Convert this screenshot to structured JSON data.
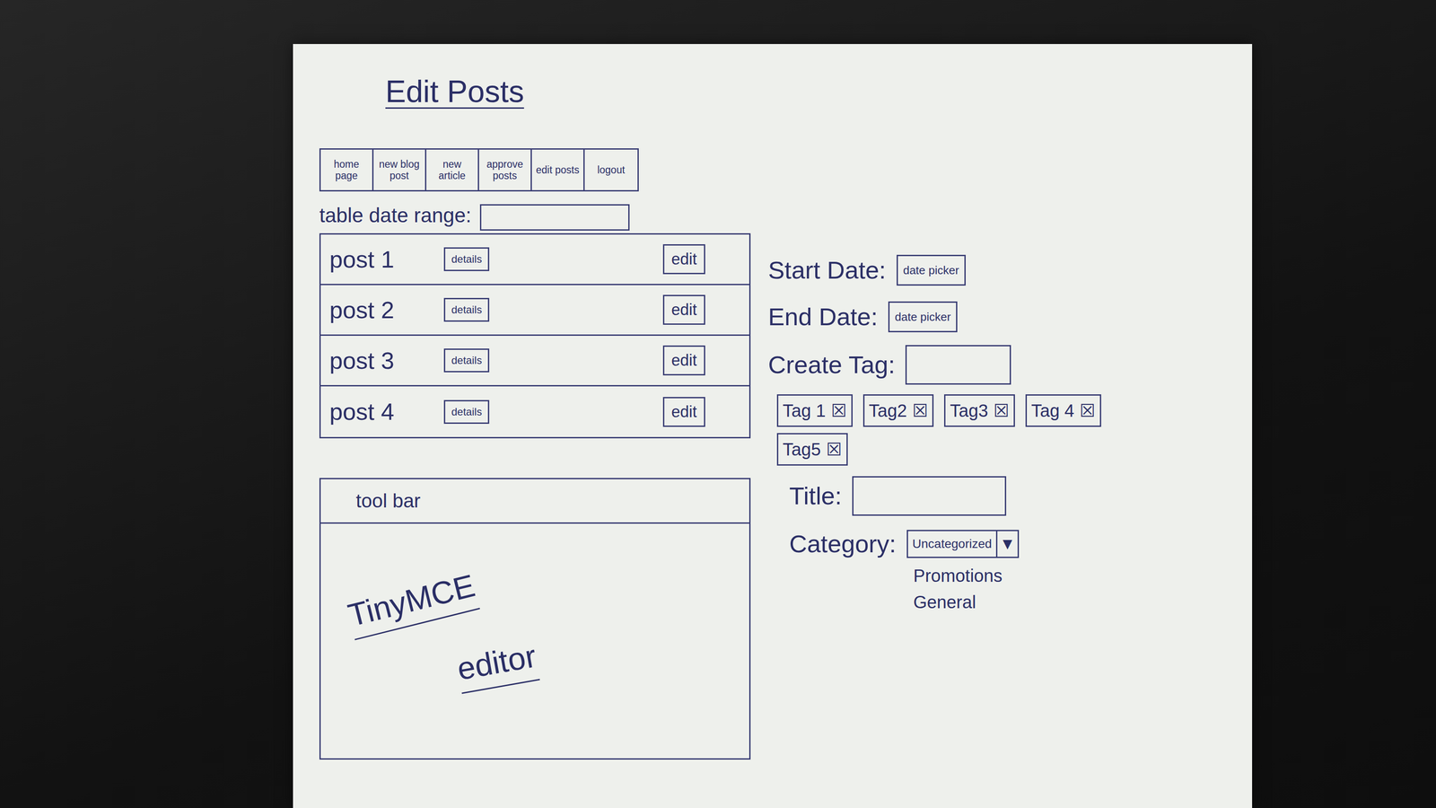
{
  "page": {
    "title": "Edit Posts"
  },
  "nav": [
    {
      "label": "home page"
    },
    {
      "label": "new blog post"
    },
    {
      "label": "new article"
    },
    {
      "label": "approve posts"
    },
    {
      "label": "edit posts"
    },
    {
      "label": "logout"
    }
  ],
  "table": {
    "range_label": "table date range:",
    "rows": [
      {
        "name": "post 1",
        "details": "details",
        "edit": "edit"
      },
      {
        "name": "post 2",
        "details": "details",
        "edit": "edit"
      },
      {
        "name": "post 3",
        "details": "details",
        "edit": "edit"
      },
      {
        "name": "post 4",
        "details": "details",
        "edit": "edit"
      }
    ]
  },
  "editor": {
    "toolbar": "tool bar",
    "body": [
      "TinyMCE",
      "editor"
    ]
  },
  "form": {
    "start_date": {
      "label": "Start Date:",
      "field": "date picker"
    },
    "end_date": {
      "label": "End Date:",
      "field": "date picker"
    },
    "create_tag": {
      "label": "Create Tag:"
    },
    "tags": [
      {
        "label": "Tag 1",
        "remove": "☒"
      },
      {
        "label": "Tag2",
        "remove": "☒"
      },
      {
        "label": "Tag3",
        "remove": "☒"
      },
      {
        "label": "Tag 4",
        "remove": "☒"
      },
      {
        "label": "Tag5",
        "remove": "☒"
      }
    ],
    "title": {
      "label": "Title:"
    },
    "category": {
      "label": "Category:",
      "value": "Uncategorized",
      "arrow": "▼",
      "options": [
        "Promotions",
        "General"
      ]
    }
  }
}
